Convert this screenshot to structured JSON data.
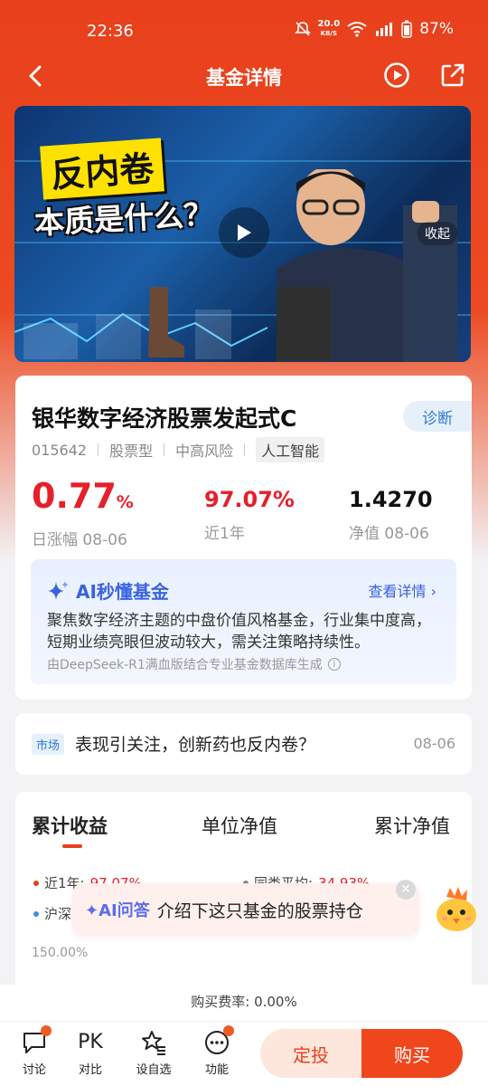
{
  "status_bar": {
    "time": "22:36",
    "net_speed_value": "20.0",
    "net_speed_unit": "KB/S",
    "battery": "87%"
  },
  "nav": {
    "title": "基金详情"
  },
  "video": {
    "title_line1": "反内卷",
    "title_line2": "本质是什么？",
    "collapse_label": "收起"
  },
  "fund": {
    "name": "银华数字经济股票发起式C",
    "diagnose_label": "诊断",
    "code": "015642",
    "type": "股票型",
    "risk": "中高风险",
    "theme": "人工智能",
    "daily_change": "0.77",
    "daily_change_unit": "%",
    "daily_change_label": "日涨幅 08-06",
    "year_return": "97.07%",
    "year_return_label": "近1年",
    "nav_value": "1.4270",
    "nav_label": "净值 08-06"
  },
  "ai_summary": {
    "title": "AI秒懂基金",
    "link": "查看详情",
    "text": "聚焦数字经济主题的中盘价值风格基金，行业集中度高，短期业绩亮眼但波动较大，需关注策略持续性。",
    "footnote": "由DeepSeek-R1满血版结合专业基金数据库生成"
  },
  "news": {
    "tag": "市场",
    "title": "表现引关注，创新药也反内卷？",
    "date": "08-06"
  },
  "chart_tabs": [
    "累计收益",
    "单位净值",
    "累计净值"
  ],
  "chart_legend": {
    "fund_label": "近1年:",
    "fund_value": "97.07%",
    "peer_label": "同类平均:",
    "peer_value": "34.93%",
    "index_label": "沪深"
  },
  "chart_y_top": "150.00%",
  "ai_ask": {
    "tag": "AI问答",
    "text": "介绍下这只基金的股票持仓"
  },
  "fee": "购买费率: 0.00%",
  "bottom_bar": {
    "discuss": "讨论",
    "pk_glyph": "PK",
    "compare": "对比",
    "watch": "设自选",
    "functions": "功能",
    "auto_invest": "定投",
    "buy": "购买"
  },
  "colors": {
    "brand": "#e8401c",
    "up": "#e5202b",
    "ai_blue": "#3a63e0"
  }
}
